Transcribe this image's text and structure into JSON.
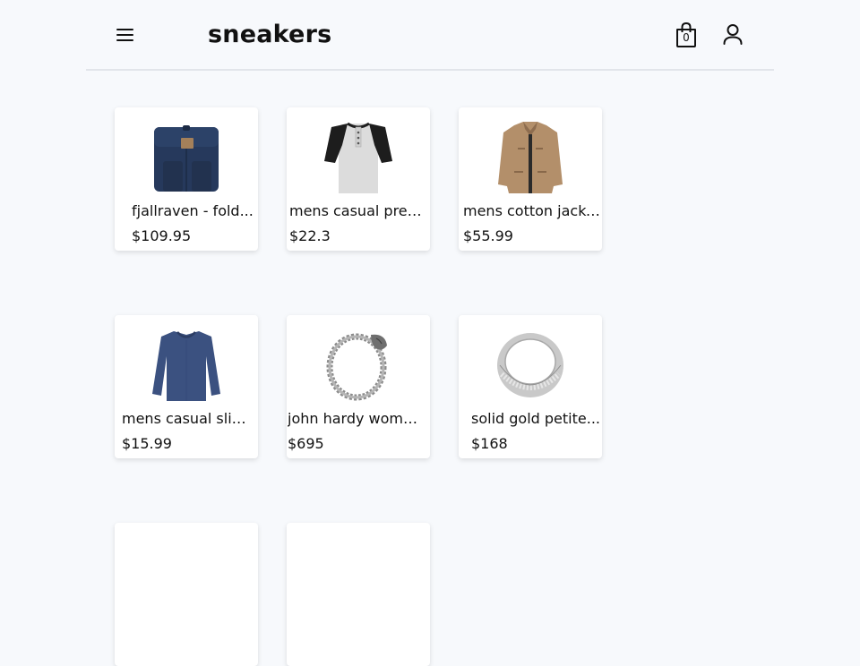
{
  "header": {
    "logo": "sneakers",
    "cart_count": "0",
    "menu_icon": "hamburger-menu-icon",
    "cart_icon": "shopping-bag-icon",
    "user_icon": "user-icon"
  },
  "products": [
    {
      "title": "fjallraven - fold...",
      "price": "$109.95",
      "image": "backpack"
    },
    {
      "title": "mens casual premi...",
      "price": "$22.3",
      "image": "henley-shirt"
    },
    {
      "title": "mens cotton jacke...",
      "price": "$55.99",
      "image": "jacket"
    },
    {
      "title": "mens casual slim ...",
      "price": "$15.99",
      "image": "long-sleeve-shirt"
    },
    {
      "title": "john hardy women'...",
      "price": "$695",
      "image": "bracelet"
    },
    {
      "title": "solid gold petite...",
      "price": "$168",
      "image": "ring"
    }
  ],
  "colors": {
    "background": "#f7f9fc",
    "card": "#ffffff",
    "text": "#111111",
    "divider": "#e2e5ea"
  }
}
